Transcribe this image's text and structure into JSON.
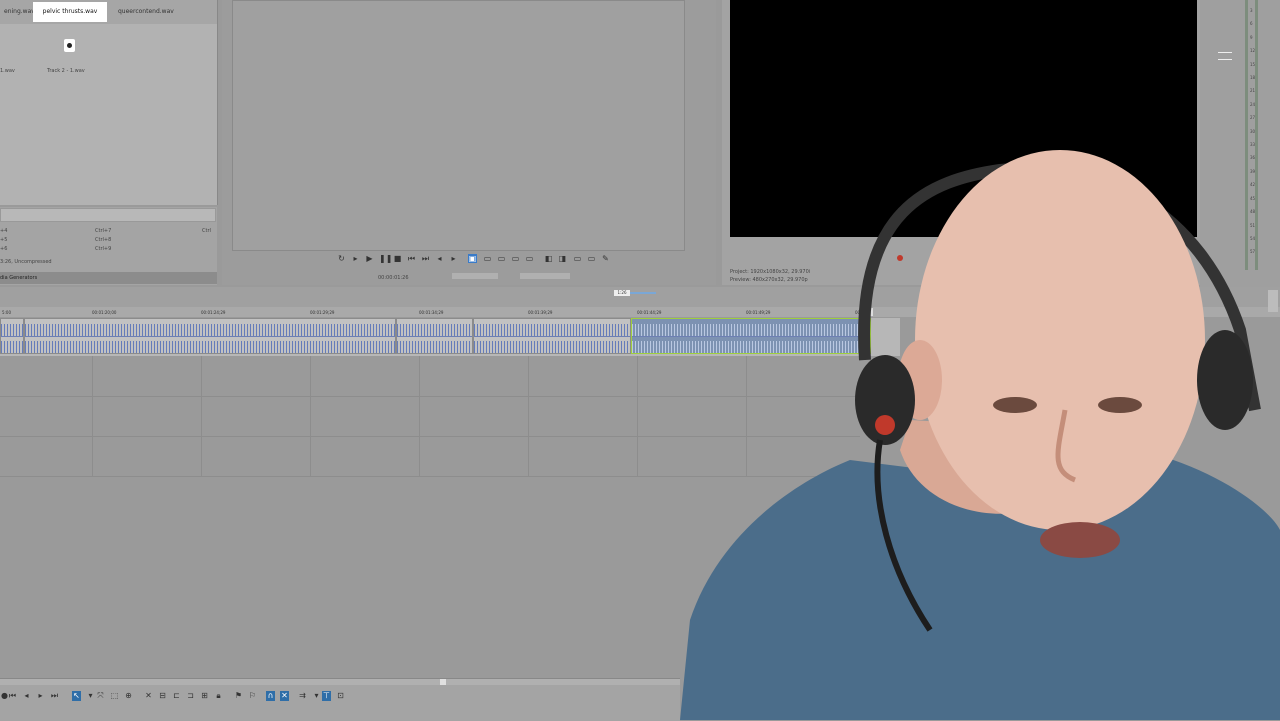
{
  "explorer": {
    "tabs": [
      "ening.wav",
      "pelvic thrusts.wav",
      "queercontend.wav"
    ],
    "active_tab": "pelvic thrusts.wav",
    "files": [
      "1.wav",
      "Track 2 - 1.wav"
    ]
  },
  "shortcuts": [
    {
      "key": "+4",
      "shortcut": "Ctrl+7",
      "mod": "Ctrl"
    },
    {
      "key": "+5",
      "shortcut": "Ctrl+8",
      "mod": ""
    },
    {
      "key": "+6",
      "shortcut": "Ctrl+9",
      "mod": ""
    }
  ],
  "format_info": "3:26, Uncompressed",
  "generators_tab": "dia Generators",
  "trimmer": {
    "position": "00:00:01:26"
  },
  "preview": {
    "project": "Project: 1920x1080x32, 29.970i",
    "preview_info": "Preview: 480x270x32, 29.970p"
  },
  "timeline": {
    "marker_label": "1:26",
    "ticks": [
      "5:00",
      "00:01:20;00",
      "00:01:24;29",
      "00:01:29;29",
      "00:01:34;29",
      "00:01:39;29",
      "00:01:44;29",
      "00:01:49;29",
      "00:01:5"
    ]
  },
  "meter_labels": [
    "3",
    "6",
    "9",
    "12",
    "15",
    "18",
    "21",
    "24",
    "27",
    "30",
    "33",
    "36",
    "39",
    "42",
    "45",
    "48",
    "51",
    "54",
    "57"
  ],
  "colors": {
    "waveform": "#4e6ab8",
    "selection_border": "#9fcf3c",
    "active_toolbar": "#2f6ea8"
  }
}
